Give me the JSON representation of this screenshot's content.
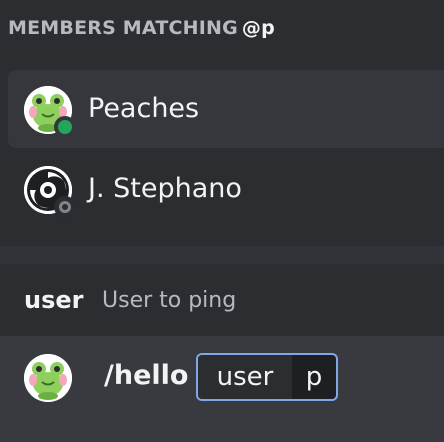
{
  "header": {
    "prefix": "MEMBERS MATCHING",
    "query": "@p"
  },
  "members": [
    {
      "name": "Peaches",
      "status": "online",
      "selected": true,
      "avatar_icon": "frog-avatar-icon"
    },
    {
      "name": "J. Stephano",
      "status": "offline",
      "selected": false,
      "avatar_icon": "swirl-avatar-icon"
    }
  ],
  "parameter": {
    "name": "user",
    "description": "User to ping"
  },
  "command": {
    "name": "/hello",
    "option_label": "user",
    "option_value": "p",
    "avatar_icon": "frog-avatar-icon"
  },
  "colors": {
    "background": "#313338",
    "panel": "#2b2d31",
    "selected": "#35373c",
    "online": "#23a55a",
    "offline": "#80848e",
    "chip_border": "#80a7e8",
    "text": "#f2f3f5",
    "muted": "#b5bac1"
  }
}
